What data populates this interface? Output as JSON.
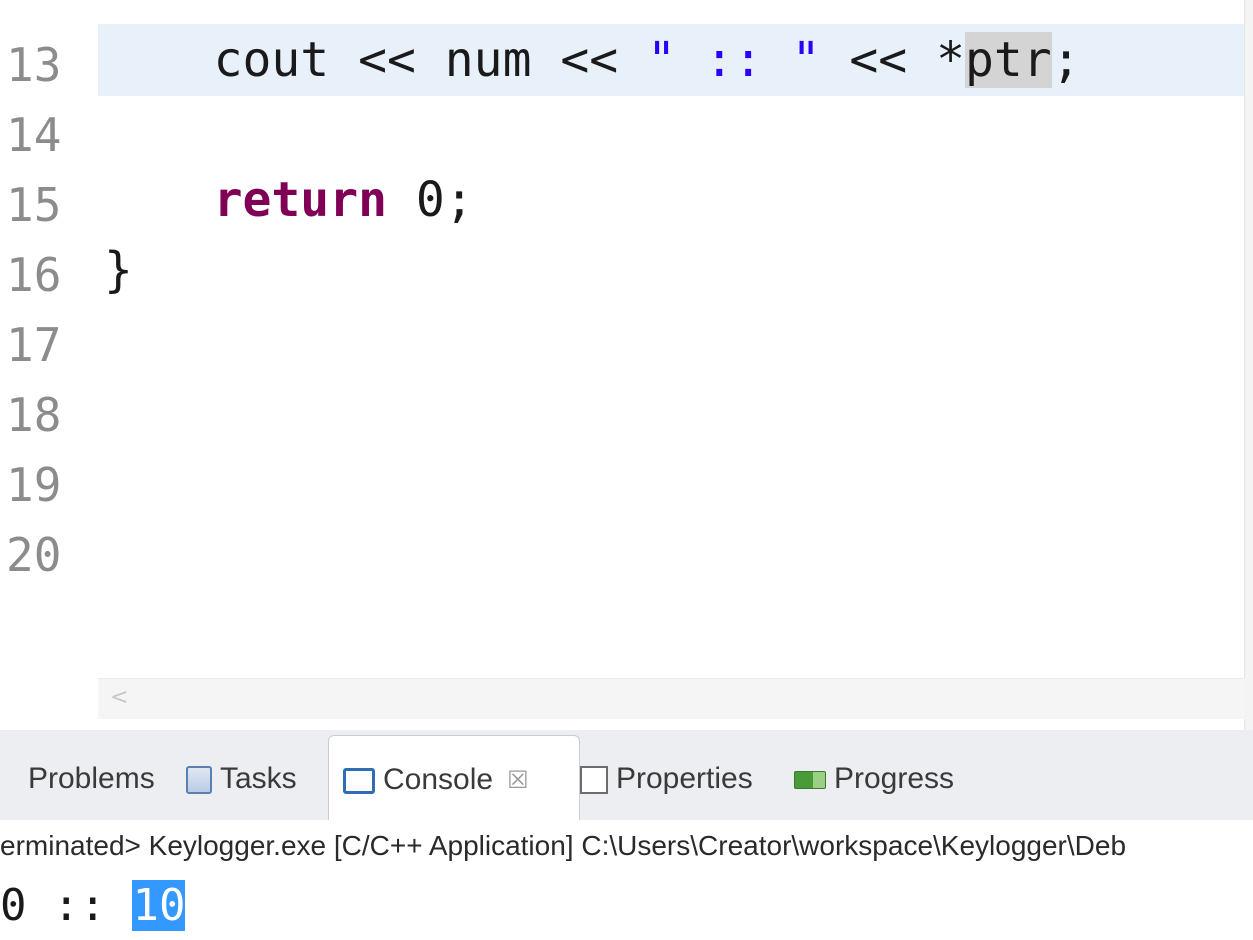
{
  "editor": {
    "line_numbers": [
      "13",
      "14",
      "15",
      "16",
      "17",
      "18",
      "19",
      "20"
    ],
    "line13": {
      "t1": "    cout << num << ",
      "t2": "\" :: \"",
      "t3": " << *",
      "t4": "ptr",
      "t5": ";"
    },
    "line15": {
      "indent": "    ",
      "kw": "return",
      "rest": " 0;"
    },
    "line16": "}",
    "hscroll_left_arrow": "<",
    "colors": {
      "keyword": "#7f0055",
      "string": "#2a00ff",
      "current_line": "#e8f0fa",
      "line_number": "#8c8c8c"
    }
  },
  "panel": {
    "tabs": [
      {
        "label": "Problems",
        "icon": ""
      },
      {
        "label": "Tasks",
        "icon": "tasks-icon"
      },
      {
        "label": "Console",
        "icon": "console-icon",
        "active": true,
        "close": "☒"
      },
      {
        "label": "Properties",
        "icon": "properties-icon"
      },
      {
        "label": "Progress",
        "icon": "progress-icon"
      }
    ],
    "console_header": "erminated> Keylogger.exe [C/C++ Application] C:\\Users\\Creator\\workspace\\Keylogger\\Deb",
    "output": {
      "prefix": "0 :: ",
      "selected": "10"
    },
    "colors": {
      "selection": "#3399ff"
    }
  }
}
